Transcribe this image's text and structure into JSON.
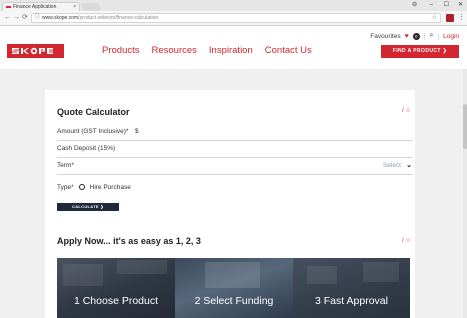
{
  "browser": {
    "tab_title": "Finance Application",
    "tab_close": "×",
    "url_host": "www.skope.com",
    "url_path": "/product-selector/finance-calculation",
    "window_user": "⊖",
    "window_min": "–",
    "window_max": "☐",
    "window_close": "✕"
  },
  "header": {
    "nav": [
      "Products",
      "Resources",
      "Inspiration",
      "Contact Us"
    ],
    "favourites_label": "Favourites",
    "favourites_count": "0",
    "login_label": "Login",
    "find_button": "FIND A PRODUCT ❯"
  },
  "calculator": {
    "title": "Quote Calculator",
    "fav_link": "/ ☆",
    "amount_label": "Amount (GST Inclusive)*",
    "amount_value": "$",
    "deposit_label": "Cash Deposit (15%)",
    "term_label": "Term*",
    "term_placeholder": "Select",
    "type_label": "Type*",
    "type_option": "Hire Purchase",
    "calculate_button": "CALCULATE ❯"
  },
  "apply": {
    "title": "Apply Now... it's as easy as 1, 2, 3",
    "fav_link": "/ ☆",
    "steps": [
      "1 Choose Product",
      "2 Select Funding",
      "3 Fast Approval"
    ]
  },
  "colors": {
    "brand_red": "#d22630",
    "dark_button": "#1f2a3a",
    "page_bg": "#f0f0f0"
  },
  "icons": [
    "back-arrow-icon",
    "forward-arrow-icon",
    "reload-icon",
    "info-icon",
    "star-icon",
    "menu-icon",
    "heart-icon",
    "search-icon",
    "chevron-down-icon"
  ]
}
